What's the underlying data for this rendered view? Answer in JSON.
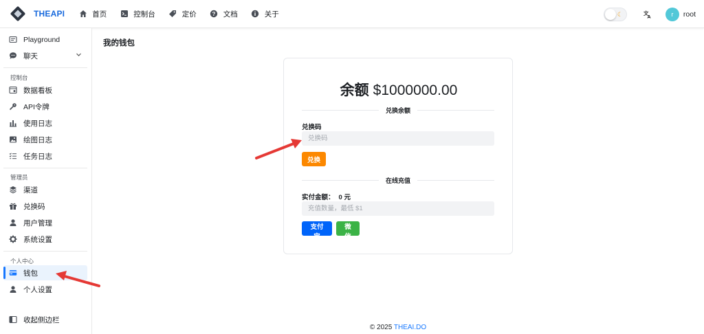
{
  "header": {
    "brand": "THEAPI",
    "nav": [
      {
        "label": "首页",
        "icon": "home-icon"
      },
      {
        "label": "控制台",
        "icon": "terminal-icon"
      },
      {
        "label": "定价",
        "icon": "tag-icon"
      },
      {
        "label": "文档",
        "icon": "help-icon"
      },
      {
        "label": "关于",
        "icon": "info-icon"
      }
    ],
    "lang_icon": "translate-icon",
    "avatar_letter": "r",
    "username": "root"
  },
  "sidebar": {
    "top_items": [
      {
        "label": "Playground",
        "icon": "chat-square-icon"
      },
      {
        "label": "聊天",
        "icon": "chat-bubble-icon"
      }
    ],
    "sections": [
      {
        "title": "控制台",
        "items": [
          {
            "label": "数据看板",
            "icon": "dashboard-icon"
          },
          {
            "label": "API令牌",
            "icon": "key-icon"
          },
          {
            "label": "使用日志",
            "icon": "bar-chart-icon"
          },
          {
            "label": "绘图日志",
            "icon": "image-icon"
          },
          {
            "label": "任务日志",
            "icon": "task-list-icon"
          }
        ]
      },
      {
        "title": "管理员",
        "items": [
          {
            "label": "渠道",
            "icon": "layers-icon"
          },
          {
            "label": "兑换码",
            "icon": "gift-icon"
          },
          {
            "label": "用户管理",
            "icon": "user-icon"
          },
          {
            "label": "系统设置",
            "icon": "gear-icon"
          }
        ]
      },
      {
        "title": "个人中心",
        "items": [
          {
            "label": "钱包",
            "icon": "credit-card-icon",
            "active": true
          },
          {
            "label": "个人设置",
            "icon": "user-settings-icon"
          }
        ]
      }
    ],
    "collapse_label": "收起侧边栏"
  },
  "main": {
    "page_title": "我的钱包",
    "balance_label": "余额",
    "balance_value": "$1000000.00",
    "redeem_section_title": "兑换余额",
    "redeem_label": "兑换码",
    "redeem_placeholder": "兑换码",
    "redeem_button": "兑换",
    "topup_section_title": "在线充值",
    "pay_amount_label": "实付金额：",
    "pay_amount_value": "0 元",
    "topup_placeholder": "充值数量，最低 $1",
    "alipay_button": "支付宝",
    "wechat_button": "微信"
  },
  "footer": {
    "copyright": "© 2025",
    "link": "THEAI.DO"
  },
  "colors": {
    "accent": "#1677ff",
    "redeem": "#fc8800",
    "alipay": "#0064fa",
    "wechat": "#3bb346",
    "annotation": "#e53935"
  }
}
